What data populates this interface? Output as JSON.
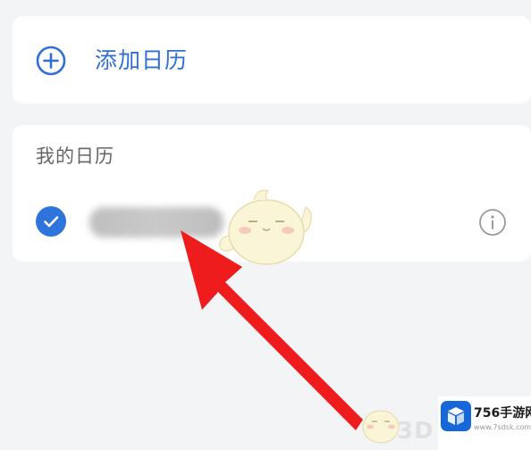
{
  "add_calendar": {
    "label": "添加日历",
    "icon": "plus-circle-icon"
  },
  "my_calendars": {
    "title": "我的日历",
    "items": [
      {
        "checked": true,
        "name_blurred": true,
        "info_icon": "info-circle-icon"
      }
    ]
  },
  "colors": {
    "accent": "#2f74dd",
    "background": "#f3f4f6",
    "card": "#ffffff",
    "arrow": "#ee1c1c"
  },
  "watermark": {
    "brand_name": "756手游网",
    "brand_url": "www.7sdsk.com",
    "faint_text": "3D"
  }
}
